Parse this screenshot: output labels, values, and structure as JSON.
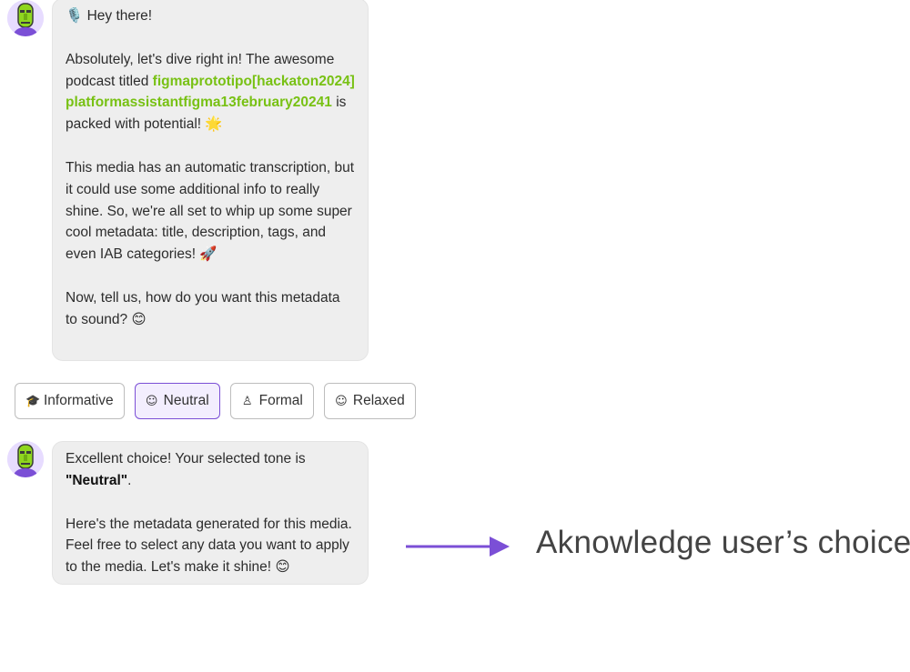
{
  "colors": {
    "accent": "#7b4fd6",
    "link": "#78c114",
    "bubble_bg": "#eeeeee"
  },
  "message1": {
    "avatar_icon": "moai-robot-avatar-icon",
    "greeting": "🎙️ Hey there!",
    "p2_before": "Absolutely, let's dive right in! The awesome podcast titled ",
    "p2_link": "figmaprototipo[hackaton2024]platformassistantfigma13february20241",
    "p2_after": " is packed with potential! 🌟",
    "p3": "This media has an automatic transcription, but it could use some additional info to really shine. So, we're all set to whip up some super cool metadata: title, description, tags, and even IAB categories! 🚀",
    "p4": "Now, tell us, how do you want this metadata to sound? 😊"
  },
  "tones": [
    {
      "icon": "🎓",
      "icon_name": "graduation-cap-icon",
      "label": "Informative",
      "selected": false
    },
    {
      "icon": "☺",
      "icon_name": "neutral-face-icon",
      "label": "Neutral",
      "selected": true
    },
    {
      "icon": "♙",
      "icon_name": "person-icon",
      "label": "Formal",
      "selected": false
    },
    {
      "icon": "☺",
      "icon_name": "smile-icon",
      "label": "Relaxed",
      "selected": false
    }
  ],
  "message2": {
    "avatar_icon": "moai-robot-avatar-icon",
    "p1_before": "Excellent choice! Your selected tone is ",
    "p1_bold": "\"Neutral\"",
    "p1_after": ".",
    "p2": "Here's the metadata generated for this media. Feel free to select any data you want to apply to the media. Let's make it shine! 😊"
  },
  "annotation": {
    "text": "Aknowledge user’s choice",
    "arrow_icon": "arrow-right-icon"
  }
}
